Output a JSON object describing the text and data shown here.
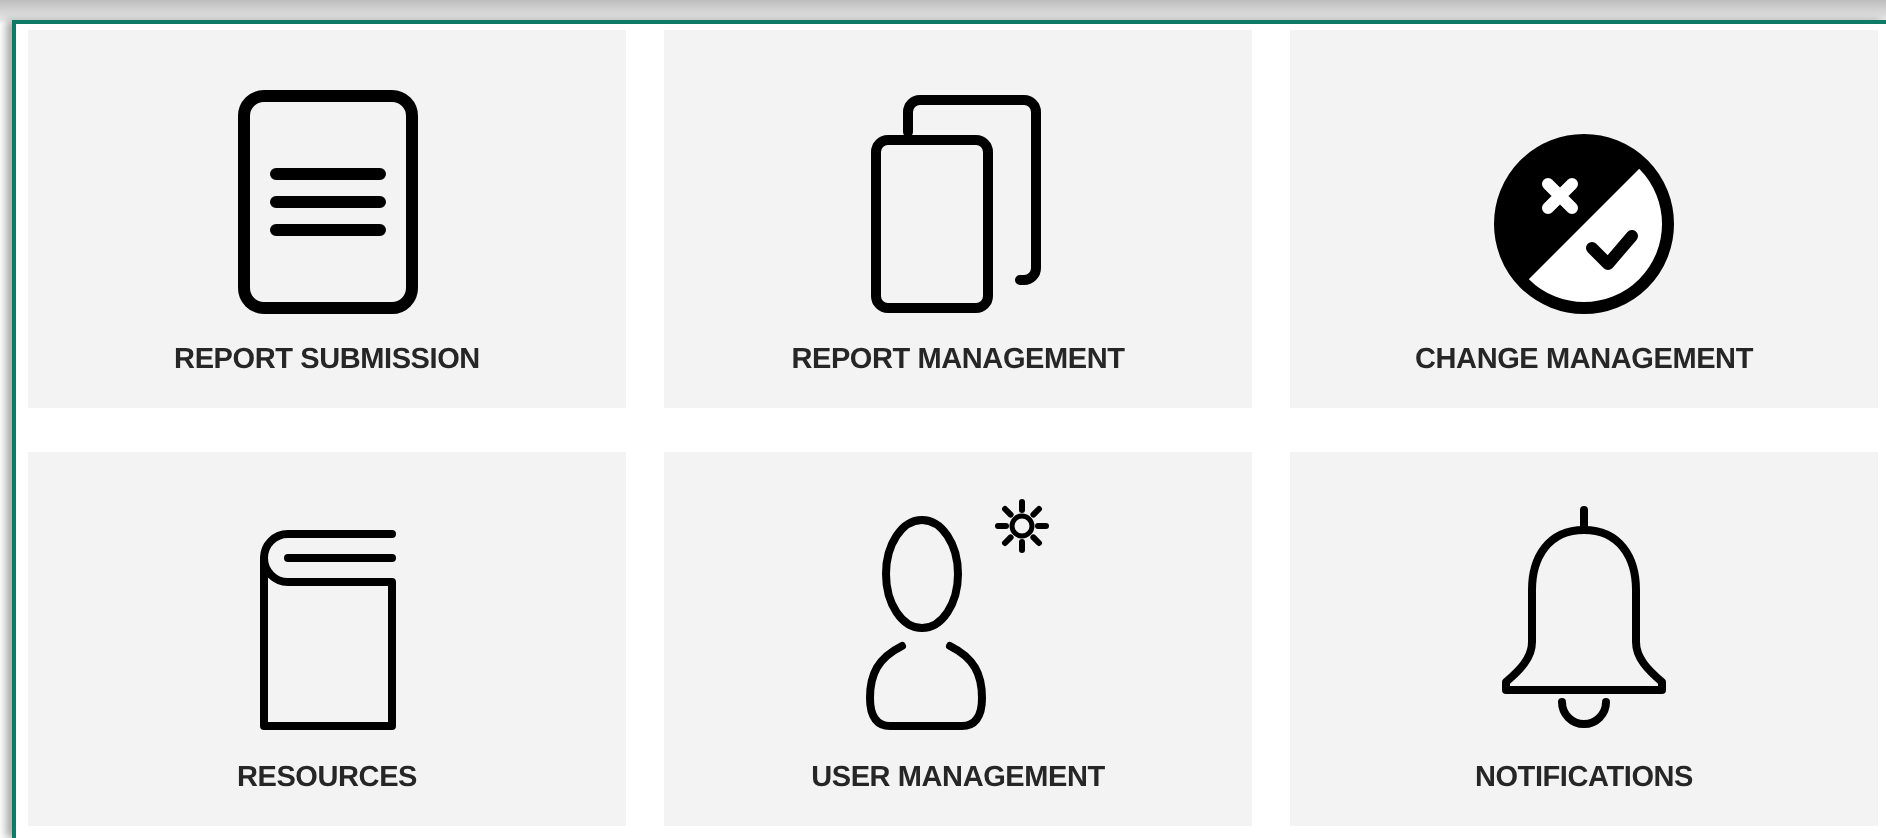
{
  "tiles": [
    {
      "kind": "document",
      "label": "REPORT SUBMISSION"
    },
    {
      "kind": "copies",
      "label": "REPORT MANAGEMENT"
    },
    {
      "kind": "change",
      "label": "CHANGE MANAGEMENT"
    },
    {
      "kind": "book",
      "label": "RESOURCES"
    },
    {
      "kind": "user",
      "label": "USER MANAGEMENT"
    },
    {
      "kind": "bell",
      "label": "NOTIFICATIONS"
    }
  ]
}
